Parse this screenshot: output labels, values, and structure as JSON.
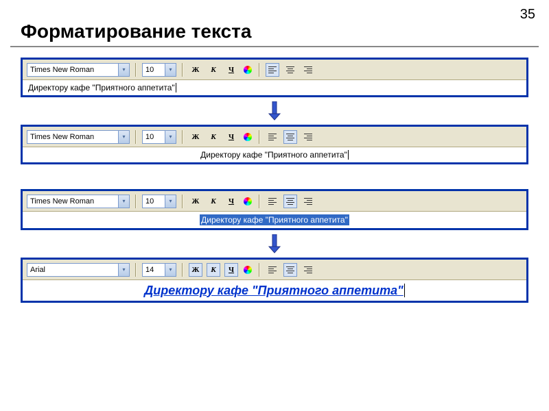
{
  "page_number": "35",
  "title": "Форматирование текста",
  "panels": [
    {
      "font": "Times New Roman",
      "size": "10",
      "bold": "Ж",
      "italic": "К",
      "underline": "Ч",
      "text": "Директору кафе \"Приятного аппетита\"",
      "align": "left",
      "active_align": "left",
      "selected": false,
      "formatted": false,
      "bold_active": false,
      "italic_active": false,
      "underline_active": false
    },
    {
      "font": "Times New Roman",
      "size": "10",
      "bold": "Ж",
      "italic": "К",
      "underline": "Ч",
      "text": "Директору кафе \"Приятного аппетита\"",
      "align": "center",
      "active_align": "center",
      "selected": false,
      "formatted": false,
      "bold_active": false,
      "italic_active": false,
      "underline_active": false
    },
    {
      "font": "Times New Roman",
      "size": "10",
      "bold": "Ж",
      "italic": "К",
      "underline": "Ч",
      "text": "Директору кафе \"Приятного аппетита\"",
      "align": "center",
      "active_align": "center",
      "selected": true,
      "formatted": false,
      "bold_active": false,
      "italic_active": false,
      "underline_active": false
    },
    {
      "font": "Arial",
      "size": "14",
      "bold": "Ж",
      "italic": "К",
      "underline": "Ч",
      "text": "Директору кафе \"Приятного аппетита\"",
      "align": "center",
      "active_align": "center",
      "selected": false,
      "formatted": true,
      "bold_active": true,
      "italic_active": true,
      "underline_active": true
    }
  ]
}
